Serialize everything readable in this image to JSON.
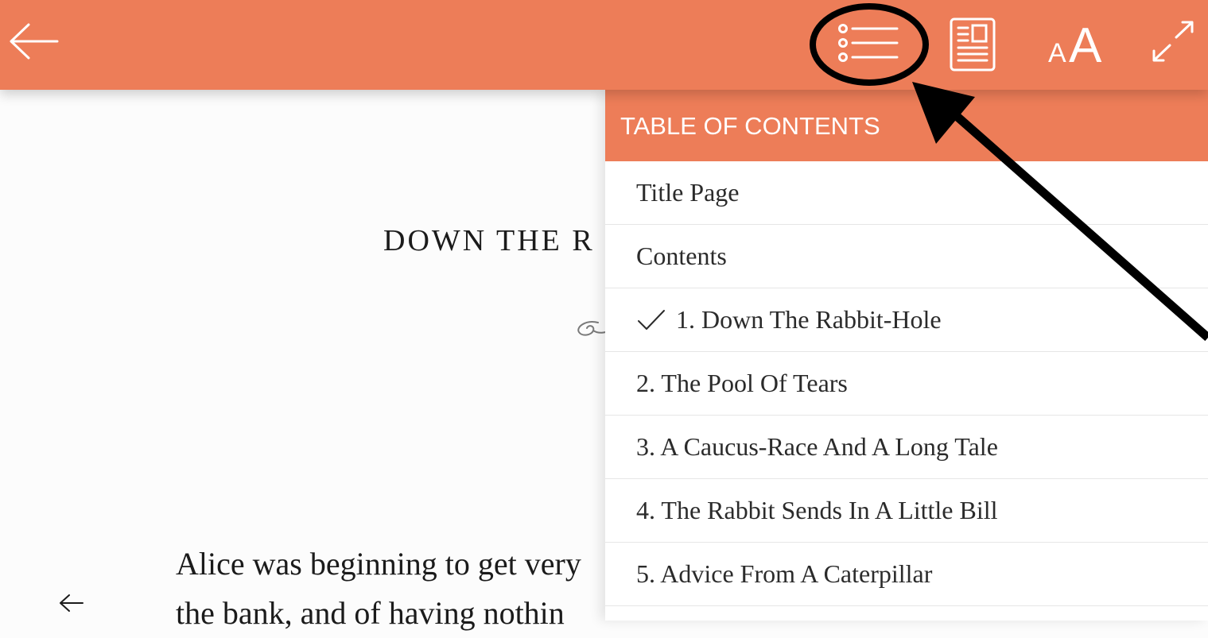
{
  "toolbar": {
    "icons": [
      "back-arrow-icon",
      "table-of-contents-icon",
      "page-layout-icon",
      "font-size-icon",
      "fullscreen-icon"
    ],
    "font_size_small": "A",
    "font_size_large": "A",
    "accent_color": "#ed7d58"
  },
  "reader": {
    "chapter_title": "DOWN THE R",
    "body_lines": [
      "Alice was beginning to get very",
      "the bank, and of having nothin"
    ],
    "prev_page_icon": "left-arrow-icon"
  },
  "toc": {
    "header": "TABLE OF CONTENTS",
    "items": [
      {
        "label": "Title Page",
        "current": false
      },
      {
        "label": "Contents",
        "current": false
      },
      {
        "label": "1. Down The Rabbit-Hole",
        "current": true
      },
      {
        "label": "2. The Pool Of Tears",
        "current": false
      },
      {
        "label": "3. A Caucus-Race And A Long Tale",
        "current": false
      },
      {
        "label": "4. The Rabbit Sends In A Little Bill",
        "current": false
      },
      {
        "label": "5. Advice From A Caterpillar",
        "current": false
      }
    ],
    "current_marker_icon": "checkmark-icon"
  },
  "annotation": {
    "shapes": [
      "highlight-circle",
      "pointer-arrow"
    ],
    "color": "#000000"
  }
}
